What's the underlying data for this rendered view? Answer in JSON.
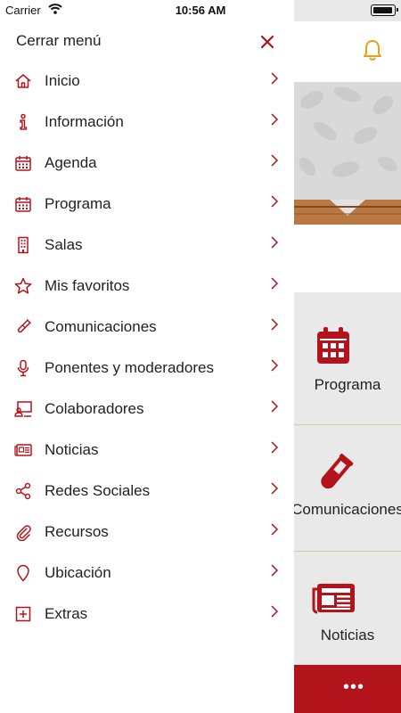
{
  "status_bar": {
    "carrier": "Carrier",
    "time": "10:56 AM"
  },
  "drawer": {
    "close_label": "Cerrar menú",
    "items": [
      {
        "label": "Inicio",
        "icon": "home-icon"
      },
      {
        "label": "Información",
        "icon": "info-icon"
      },
      {
        "label": "Agenda",
        "icon": "calendar-icon"
      },
      {
        "label": "Programa",
        "icon": "calendar-icon"
      },
      {
        "label": "Salas",
        "icon": "building-icon"
      },
      {
        "label": "Mis favoritos",
        "icon": "star-icon"
      },
      {
        "label": "Comunicaciones",
        "icon": "test-tube-icon"
      },
      {
        "label": "Ponentes y moderadores",
        "icon": "microphone-icon"
      },
      {
        "label": "Colaboradores",
        "icon": "presenter-icon"
      },
      {
        "label": "Noticias",
        "icon": "newspaper-icon"
      },
      {
        "label": "Redes Sociales",
        "icon": "share-icon"
      },
      {
        "label": "Recursos",
        "icon": "paperclip-icon"
      },
      {
        "label": "Ubicación",
        "icon": "location-pin-icon"
      },
      {
        "label": "Extras",
        "icon": "plus-box-icon"
      }
    ]
  },
  "background": {
    "tiles": [
      {
        "label": "Programa",
        "icon": "calendar-icon"
      },
      {
        "label": "Comunicaciones",
        "icon": "test-tube-icon"
      },
      {
        "label": "Noticias",
        "icon": "newspaper-icon"
      }
    ],
    "bottom_more": "•••"
  },
  "colors": {
    "accent": "#b3141c",
    "bell": "#e3a21a",
    "text": "#222222"
  }
}
